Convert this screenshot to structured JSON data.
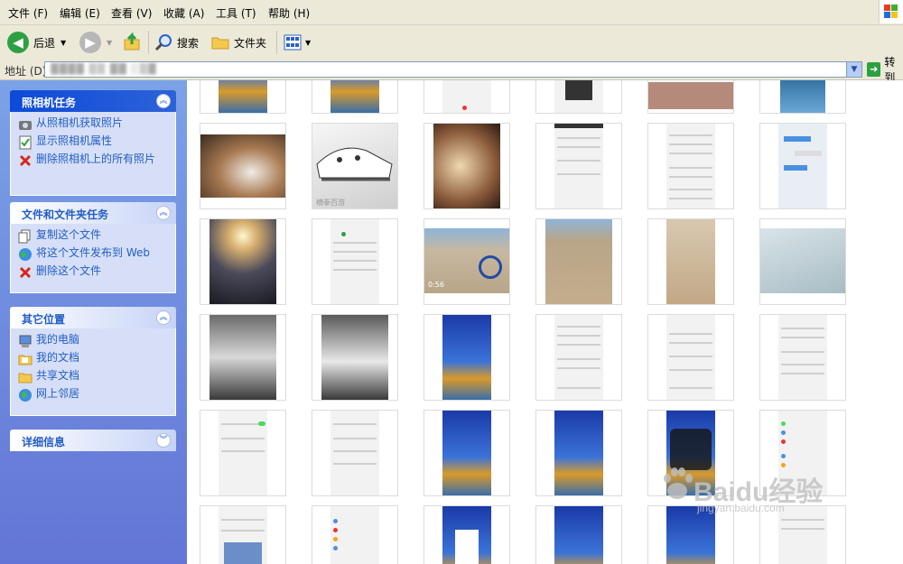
{
  "menu": [
    "文件 (F)",
    "编辑 (E)",
    "查看 (V)",
    "收藏 (A)",
    "工具 (T)",
    "帮助 (H)"
  ],
  "toolbar": {
    "back": "后退",
    "search": "搜索",
    "folders": "文件夹"
  },
  "address": {
    "label": "地址 (D)",
    "value": "▓▓▓▓ ▒▒ ▓▓ ░▒▓",
    "go": "转到"
  },
  "panels": [
    {
      "title": "照相机任务",
      "items": [
        "从照相机获取照片",
        "显示照相机属性",
        "删除照相机上的所有照片"
      ]
    },
    {
      "title": "文件和文件夹任务",
      "items": [
        "复制这个文件",
        "将这个文件发布到 Web",
        "删除这个文件"
      ]
    },
    {
      "title": "其它位置",
      "items": [
        "我的电脑",
        "我的文档",
        "共享文档",
        "网上邻居"
      ]
    },
    {
      "title": "详细信息",
      "items": []
    }
  ],
  "thumbs": {
    "shoes_caption": "横拳百游",
    "photo_timestamp": "0:56"
  },
  "watermark": {
    "brand": "Baidu经验",
    "url": "jingyan.baidu.com"
  },
  "colors": {
    "accent": "#215dc6",
    "pane_top": "#7ba2e7",
    "pane_bottom": "#6375d6"
  }
}
